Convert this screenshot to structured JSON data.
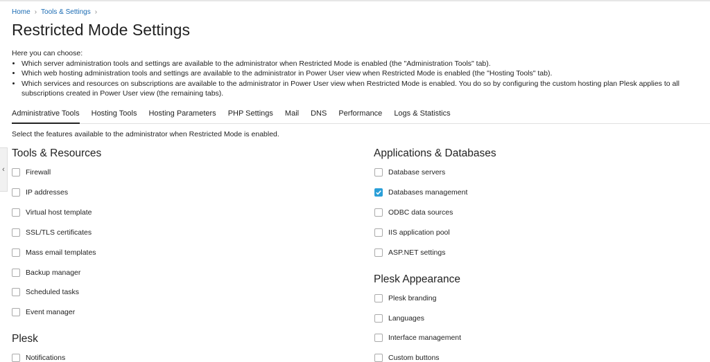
{
  "breadcrumb": {
    "home": "Home",
    "tools": "Tools & Settings"
  },
  "page": {
    "title": "Restricted Mode Settings"
  },
  "intro": {
    "lead": "Here you can choose:",
    "items": [
      "Which server administration tools and settings are available to the administrator when Restricted Mode is enabled (the \"Administration Tools\" tab).",
      "Which web hosting administration tools and settings are available to the administrator in Power User view when Restricted Mode is enabled (the \"Hosting Tools\" tab).",
      "Which services and resources on subscriptions are available to the administrator in Power User view when Restricted Mode is enabled. You do so by configuring the custom hosting plan Plesk applies to all subscriptions created in Power User view (the remaining tabs)."
    ]
  },
  "tabs": [
    "Administrative Tools",
    "Hosting Tools",
    "Hosting Parameters",
    "PHP Settings",
    "Mail",
    "DNS",
    "Performance",
    "Logs & Statistics"
  ],
  "description": "Select the features available to the administrator when Restricted Mode is enabled.",
  "sections": {
    "tools": {
      "title": "Tools & Resources",
      "items": [
        {
          "label": "Firewall",
          "checked": false
        },
        {
          "label": "IP addresses",
          "checked": false
        },
        {
          "label": "Virtual host template",
          "checked": false
        },
        {
          "label": "SSL/TLS certificates",
          "checked": false
        },
        {
          "label": "Mass email templates",
          "checked": false
        },
        {
          "label": "Backup manager",
          "checked": false
        },
        {
          "label": "Scheduled tasks",
          "checked": false
        },
        {
          "label": "Event manager",
          "checked": false
        }
      ]
    },
    "plesk": {
      "title": "Plesk",
      "items": [
        {
          "label": "Notifications",
          "checked": false
        }
      ]
    },
    "apps": {
      "title": "Applications & Databases",
      "items": [
        {
          "label": "Database servers",
          "checked": false
        },
        {
          "label": "Databases management",
          "checked": true
        },
        {
          "label": "ODBC data sources",
          "checked": false
        },
        {
          "label": "IIS application pool",
          "checked": false
        },
        {
          "label": "ASP.NET settings",
          "checked": false
        }
      ]
    },
    "appearance": {
      "title": "Plesk Appearance",
      "items": [
        {
          "label": "Plesk branding",
          "checked": false
        },
        {
          "label": "Languages",
          "checked": false
        },
        {
          "label": "Interface management",
          "checked": false
        },
        {
          "label": "Custom buttons",
          "checked": false
        }
      ]
    }
  },
  "colors": {
    "accent": "#2a9fd8",
    "link": "#1a6bb3"
  },
  "icons": {
    "sidebar_toggle": "chevron-left-icon",
    "breadcrumb_separator": "chevron-right-icon",
    "check": "check-icon"
  }
}
